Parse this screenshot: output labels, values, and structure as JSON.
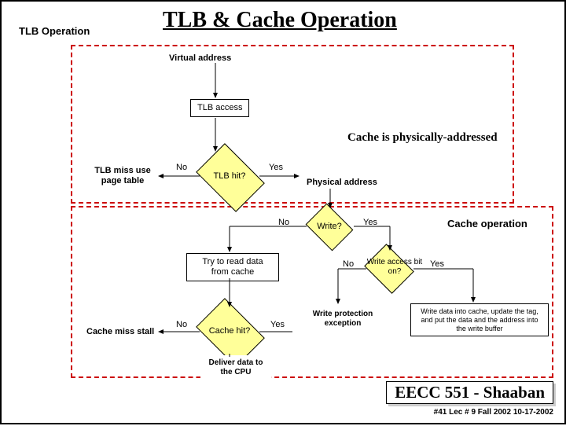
{
  "title": "TLB & Cache Operation",
  "sections": {
    "tlb": "TLB Operation",
    "cache": "Cache operation"
  },
  "note": "Cache is physically-addressed",
  "labels": {
    "virtual_addr": "Virtual address",
    "tlb_access": "TLB access",
    "tlb_hit": "TLB hit?",
    "tlb_miss": "TLB miss use page table",
    "phys_addr": "Physical address",
    "write_q": "Write?",
    "try_read": "Try to read data from cache",
    "write_access": "Write access bit on?",
    "cache_hit": "Cache hit?",
    "cache_miss_stall": "Cache miss stall",
    "write_prot": "Write protection exception",
    "write_data": "Write data into cache, update the tag, and put the data and the address into the write buffer",
    "deliver": "Deliver data to the CPU"
  },
  "edges": {
    "yes": "Yes",
    "no": "No"
  },
  "footer": {
    "course": "EECC 551 - Shaaban",
    "meta": "#41   Lec # 9   Fall 2002  10-17-2002"
  }
}
